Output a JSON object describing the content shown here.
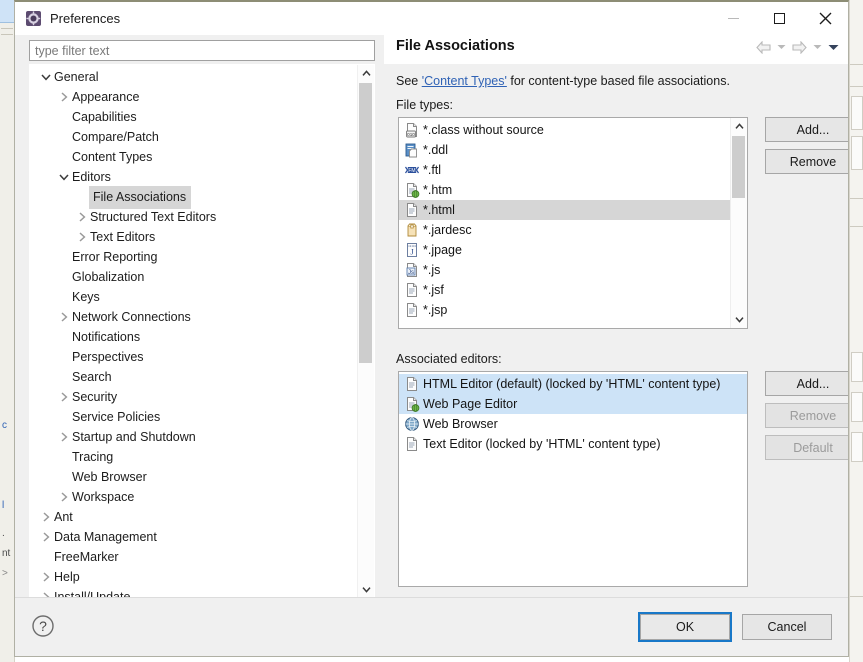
{
  "window": {
    "title": "Preferences",
    "icon": "preferences-gear-icon",
    "controls": {
      "minimize": "minimize-icon",
      "maximize": "maximize-icon",
      "close": "close-icon"
    }
  },
  "filter": {
    "placeholder": "type filter text",
    "value": ""
  },
  "tree": {
    "items": [
      {
        "label": "General",
        "indent": 0,
        "twisty": "expanded"
      },
      {
        "label": "Appearance",
        "indent": 1,
        "twisty": "collapsed"
      },
      {
        "label": "Capabilities",
        "indent": 1,
        "twisty": "none"
      },
      {
        "label": "Compare/Patch",
        "indent": 1,
        "twisty": "none"
      },
      {
        "label": "Content Types",
        "indent": 1,
        "twisty": "none"
      },
      {
        "label": "Editors",
        "indent": 1,
        "twisty": "expanded"
      },
      {
        "label": "File Associations",
        "indent": 2,
        "twisty": "none",
        "selected": true
      },
      {
        "label": "Structured Text Editors",
        "indent": 2,
        "twisty": "collapsed"
      },
      {
        "label": "Text Editors",
        "indent": 2,
        "twisty": "collapsed"
      },
      {
        "label": "Error Reporting",
        "indent": 1,
        "twisty": "none"
      },
      {
        "label": "Globalization",
        "indent": 1,
        "twisty": "none"
      },
      {
        "label": "Keys",
        "indent": 1,
        "twisty": "none"
      },
      {
        "label": "Network Connections",
        "indent": 1,
        "twisty": "collapsed"
      },
      {
        "label": "Notifications",
        "indent": 1,
        "twisty": "none"
      },
      {
        "label": "Perspectives",
        "indent": 1,
        "twisty": "none"
      },
      {
        "label": "Search",
        "indent": 1,
        "twisty": "none"
      },
      {
        "label": "Security",
        "indent": 1,
        "twisty": "collapsed"
      },
      {
        "label": "Service Policies",
        "indent": 1,
        "twisty": "none"
      },
      {
        "label": "Startup and Shutdown",
        "indent": 1,
        "twisty": "collapsed"
      },
      {
        "label": "Tracing",
        "indent": 1,
        "twisty": "none"
      },
      {
        "label": "Web Browser",
        "indent": 1,
        "twisty": "none"
      },
      {
        "label": "Workspace",
        "indent": 1,
        "twisty": "collapsed"
      },
      {
        "label": "Ant",
        "indent": 0,
        "twisty": "collapsed"
      },
      {
        "label": "Data Management",
        "indent": 0,
        "twisty": "collapsed"
      },
      {
        "label": "FreeMarker",
        "indent": 0,
        "twisty": "none"
      },
      {
        "label": "Help",
        "indent": 0,
        "twisty": "collapsed"
      },
      {
        "label": "Install/Update",
        "indent": 0,
        "twisty": "collapsed"
      }
    ]
  },
  "pane": {
    "title": "File Associations",
    "nav": {
      "back": "back-arrow-icon",
      "back_menu": "chevron-down-icon",
      "forward": "forward-arrow-icon",
      "forward_menu": "chevron-down-icon",
      "view_menu": "chevron-down-icon"
    },
    "see_prefix": "See ",
    "see_link": "'Content Types'",
    "see_suffix": " for content-type based file associations.",
    "file_types_label": "File types:",
    "associated_editors_label": "Associated editors:"
  },
  "file_types": {
    "items": [
      {
        "label": "*.class without source",
        "icon": "class-binary-file-icon"
      },
      {
        "label": "*.ddl",
        "icon": "ddl-file-icon"
      },
      {
        "label": "*.ftl",
        "icon": "freemarker-file-icon"
      },
      {
        "label": "*.htm",
        "icon": "html-web-file-icon"
      },
      {
        "label": "*.html",
        "icon": "text-file-icon",
        "selected": true
      },
      {
        "label": "*.jardesc",
        "icon": "jar-descriptor-icon"
      },
      {
        "label": "*.jpage",
        "icon": "jpage-file-icon"
      },
      {
        "label": "*.js",
        "icon": "javascript-file-icon"
      },
      {
        "label": "*.jsf",
        "icon": "text-file-icon"
      },
      {
        "label": "*.jsp",
        "icon": "text-file-icon"
      }
    ],
    "buttons": {
      "add": "Add...",
      "remove": "Remove"
    }
  },
  "associated_editors": {
    "items": [
      {
        "label": "HTML Editor (default) (locked by 'HTML' content type)",
        "icon": "text-file-icon",
        "selected": true
      },
      {
        "label": "Web Page Editor",
        "icon": "html-web-file-icon",
        "selected": true
      },
      {
        "label": "Web Browser",
        "icon": "globe-icon"
      },
      {
        "label": "Text Editor (locked by 'HTML' content type)",
        "icon": "text-file-icon"
      }
    ],
    "buttons": {
      "add": "Add...",
      "remove": "Remove",
      "default": "Default"
    }
  },
  "footer": {
    "help_icon": "help-question-icon",
    "ok": "OK",
    "cancel": "Cancel"
  },
  "colors": {
    "accent": "#1978c8",
    "link": "#2f62b5",
    "selection_blue": "#cde3f7",
    "selection_gray": "#d6d6d6",
    "dialog_bg": "#f0f0f0"
  }
}
